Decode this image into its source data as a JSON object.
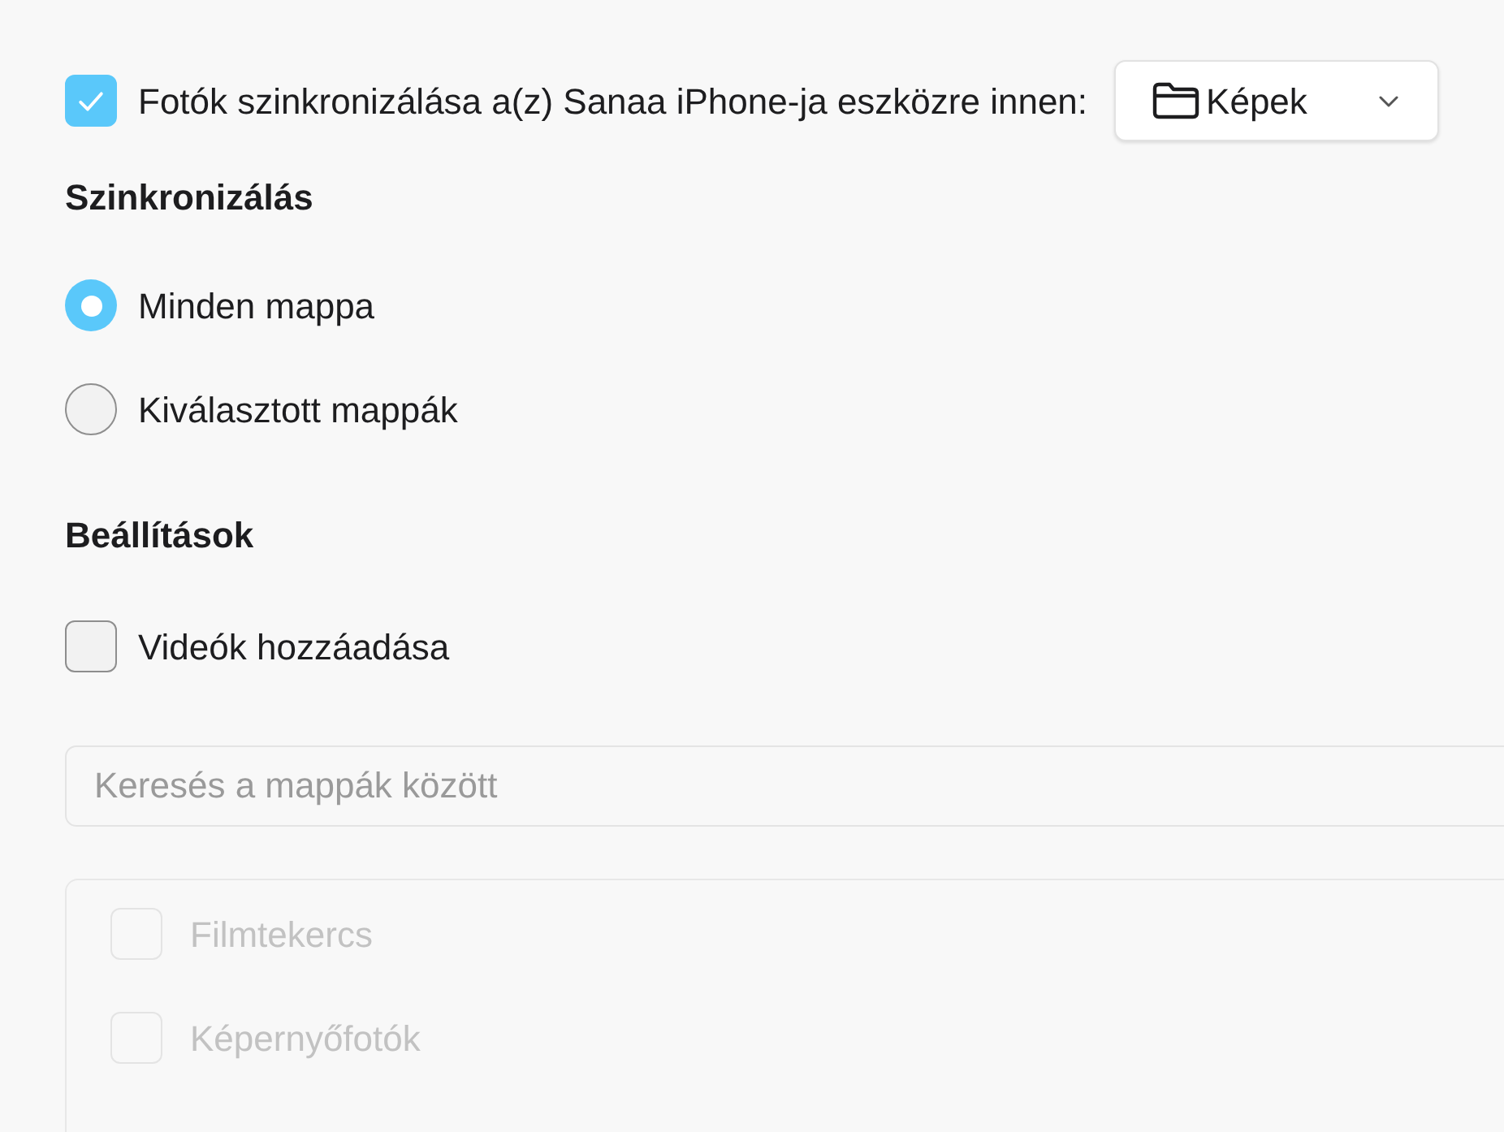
{
  "sync_photos": {
    "checked": true,
    "label": "Fotók szinkronizálása a(z) Sanaa iPhone-ja eszközre innen:",
    "source": {
      "value": "Képek"
    }
  },
  "sync": {
    "title": "Szinkronizálás",
    "options": [
      {
        "label": "Minden mappa",
        "selected": true
      },
      {
        "label": "Kiválasztott mappák",
        "selected": false
      }
    ]
  },
  "settings": {
    "title": "Beállítások",
    "options": [
      {
        "label": "Videók hozzáadása",
        "checked": false
      }
    ]
  },
  "search": {
    "placeholder": "Keresés a mappák között"
  },
  "folders": {
    "disabled": true,
    "items": [
      {
        "label": "Filmtekercs",
        "checked": false
      },
      {
        "label": "Képernyőfotók",
        "checked": false
      }
    ]
  }
}
